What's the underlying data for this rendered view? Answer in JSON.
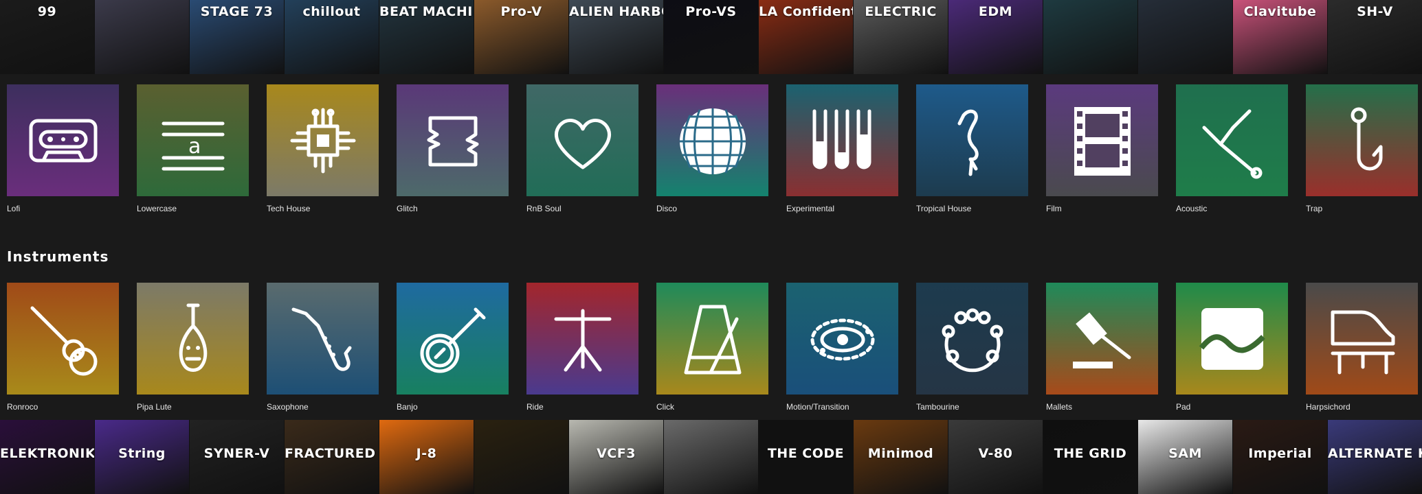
{
  "top_strip": [
    {
      "text": "99",
      "bg": "#1b1b1b"
    },
    {
      "text": "",
      "bg": "#3b3a4a"
    },
    {
      "text": "STAGE 73",
      "bg": "#2a4b73"
    },
    {
      "text": "chillout",
      "bg": "#23405a"
    },
    {
      "text": "BEAT MACHINES",
      "bg": "#22343e"
    },
    {
      "text": "Pro-V",
      "bg": "#8b5a2b"
    },
    {
      "text": "ALIEN HARBOURS",
      "bg": "#3f4a55"
    },
    {
      "text": "Pro-VS",
      "bg": "#0d0d14"
    },
    {
      "text": "LA Confidential",
      "bg": "#8a2c14"
    },
    {
      "text": "ELECTRIC",
      "bg": "#5a5a5a"
    },
    {
      "text": "EDM",
      "bg": "#4b2a78"
    },
    {
      "text": "",
      "bg": "#1e3a40"
    },
    {
      "text": "",
      "bg": "#252d38"
    },
    {
      "text": "Clavitube",
      "bg": "#c9527a"
    },
    {
      "text": "SH-V",
      "bg": "#2b2b2b"
    }
  ],
  "genres": [
    {
      "label": "Lofi",
      "icon": "cassette-icon",
      "grad": [
        "#3d2f5e",
        "#6a2e7c"
      ]
    },
    {
      "label": "Lowercase",
      "icon": "staff-letter-icon",
      "grad": [
        "#5a5f30",
        "#2e6a3a"
      ]
    },
    {
      "label": "Tech House",
      "icon": "chip-icon",
      "grad": [
        "#a8881c",
        "#7c7a68"
      ]
    },
    {
      "label": "Glitch",
      "icon": "glitch-icon",
      "grad": [
        "#5a3878",
        "#4d6a6a"
      ]
    },
    {
      "label": "RnB Soul",
      "icon": "heart-icon",
      "grad": [
        "#406866",
        "#216d57"
      ]
    },
    {
      "label": "Disco",
      "icon": "disco-ball-icon",
      "grad": [
        "#6a2f7a",
        "#14836e"
      ]
    },
    {
      "label": "Experimental",
      "icon": "test-tubes-icon",
      "grad": [
        "#1b6270",
        "#8a2f31"
      ]
    },
    {
      "label": "Tropical House",
      "icon": "flamingo-icon",
      "grad": [
        "#1e5a8a",
        "#1d3b4e"
      ]
    },
    {
      "label": "Film",
      "icon": "film-strip-icon",
      "grad": [
        "#5b3a7e",
        "#4a4a4e"
      ]
    },
    {
      "label": "Acoustic",
      "icon": "tuning-fork-icon",
      "grad": [
        "#1f6f4e",
        "#1f7d4a"
      ]
    },
    {
      "label": "Trap",
      "icon": "fish-hook-icon",
      "grad": [
        "#246f4a",
        "#9a2f2b"
      ]
    }
  ],
  "instruments_title": "Instruments",
  "instruments": [
    {
      "label": "Ronroco",
      "icon": "guitar-icon",
      "grad": [
        "#a04a18",
        "#a88a1a"
      ]
    },
    {
      "label": "Pipa Lute",
      "icon": "pipa-icon",
      "grad": [
        "#7c7a68",
        "#a8881c"
      ]
    },
    {
      "label": "Saxophone",
      "icon": "saxophone-icon",
      "grad": [
        "#5a6b6e",
        "#1d4f75"
      ]
    },
    {
      "label": "Banjo",
      "icon": "banjo-icon",
      "grad": [
        "#1f6aa0",
        "#188060"
      ]
    },
    {
      "label": "Ride",
      "icon": "cymbal-icon",
      "grad": [
        "#a3262c",
        "#4a3a8e"
      ]
    },
    {
      "label": "Click",
      "icon": "metronome-icon",
      "grad": [
        "#1f8a5a",
        "#a8881c"
      ]
    },
    {
      "label": "Motion/Transition",
      "icon": "orbit-icon",
      "grad": [
        "#1b6270",
        "#1a4f7a"
      ]
    },
    {
      "label": "Tambourine",
      "icon": "tambourine-icon",
      "grad": [
        "#1d3b4e",
        "#253545"
      ]
    },
    {
      "label": "Mallets",
      "icon": "gavel-icon",
      "grad": [
        "#1f8a5a",
        "#a84a1a"
      ]
    },
    {
      "label": "Pad",
      "icon": "pad-wave-icon",
      "grad": [
        "#1f8a4a",
        "#a8881c"
      ]
    },
    {
      "label": "Harpsichord",
      "icon": "harpsichord-icon",
      "grad": [
        "#4a4a4a",
        "#a04a18"
      ]
    }
  ],
  "bottom_strip": [
    {
      "text": "ELEKTRONIKA",
      "bg": "#2a0f3a"
    },
    {
      "text": "String",
      "bg": "#4a2a8a"
    },
    {
      "text": "SYNER-V",
      "bg": "#222"
    },
    {
      "text": "FRACTURED PIANO",
      "bg": "#3a2a1a"
    },
    {
      "text": "J-8",
      "bg": "#e06a10"
    },
    {
      "text": "",
      "bg": "#2a2110"
    },
    {
      "text": "VCF3",
      "bg": "#b8b8b0"
    },
    {
      "text": "",
      "bg": "#6a6a6a"
    },
    {
      "text": "THE CODE",
      "bg": "#111"
    },
    {
      "text": "Minimod",
      "bg": "#6a3a10"
    },
    {
      "text": "V-80",
      "bg": "#3a3a3a"
    },
    {
      "text": "THE GRID",
      "bg": "#0f0f0f"
    },
    {
      "text": "SAM",
      "bg": "#e8e8e8"
    },
    {
      "text": "Imperial",
      "bg": "#2a1a14"
    },
    {
      "text": "ALTERNATE KEYS",
      "bg": "#3a3a7a"
    }
  ]
}
